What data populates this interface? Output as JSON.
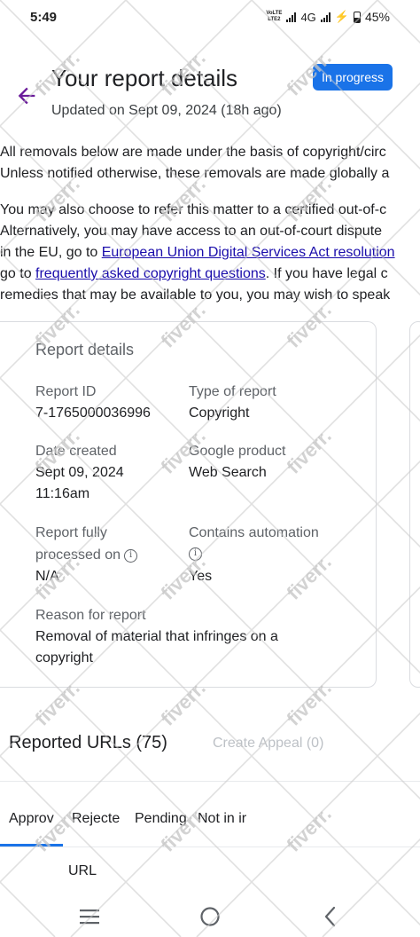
{
  "status_bar": {
    "time": "5:49",
    "volte_top": "VoLTE",
    "volte_bottom": "LTE2",
    "network": "4G",
    "battery": "45%"
  },
  "header": {
    "title": "Your report details",
    "updated": "Updated on Sept 09, 2024 (18h ago)",
    "status_chip": "In progress"
  },
  "intro": {
    "line1": "All removals below are made under the basis of copyright/circ",
    "line2": "Unless notified otherwise, these removals are made globally a",
    "p2_line1": "You may also choose to refer this matter to a certified out-of-c",
    "p2_line2": "Alternatively, you may have access to an out-of-court dispute",
    "p2_line3_prefix": "in the EU, go to ",
    "p2_line3_link": "European Union Digital Services Act resolution",
    "p2_line4_prefix": "go to ",
    "p2_line4_link": "frequently asked copyright questions",
    "p2_line4_suffix": ". If you have legal c",
    "p2_line5": "remedies that may be available to you, you may wish to speak"
  },
  "report_card": {
    "title": "Report details",
    "report_id_label": "Report ID",
    "report_id_value": "7-1765000036996",
    "type_label": "Type of report",
    "type_value": "Copyright",
    "date_label": "Date created",
    "date_value_1": "Sept 09, 2024",
    "date_value_2": "11:16am",
    "product_label": "Google product",
    "product_value": "Web Search",
    "processed_label_1": "Report fully",
    "processed_label_2": "processed on",
    "processed_value": "N/A",
    "automation_label": "Contains automation",
    "automation_value": "Yes",
    "reason_label": "Reason for report",
    "reason_value_1": "Removal of material that infringes on a",
    "reason_value_2": "copyright",
    "info_glyph": "i"
  },
  "reported_urls": {
    "title": "Reported URLs (75)",
    "appeal_button": "Create Appeal (0)"
  },
  "tabs": [
    "Approv",
    "Rejecte",
    "Pending",
    "Not in ir"
  ],
  "table": {
    "col_header": "URL"
  },
  "watermark_text": "fiverr.",
  "colors": {
    "accent": "#1a73e8",
    "link": "#1a0dab",
    "back_arrow": "#6a1b9a"
  },
  "icons": [
    "back-arrow-icon",
    "info-icon",
    "menu-icon",
    "home-circle-icon",
    "back-chevron-icon"
  ]
}
